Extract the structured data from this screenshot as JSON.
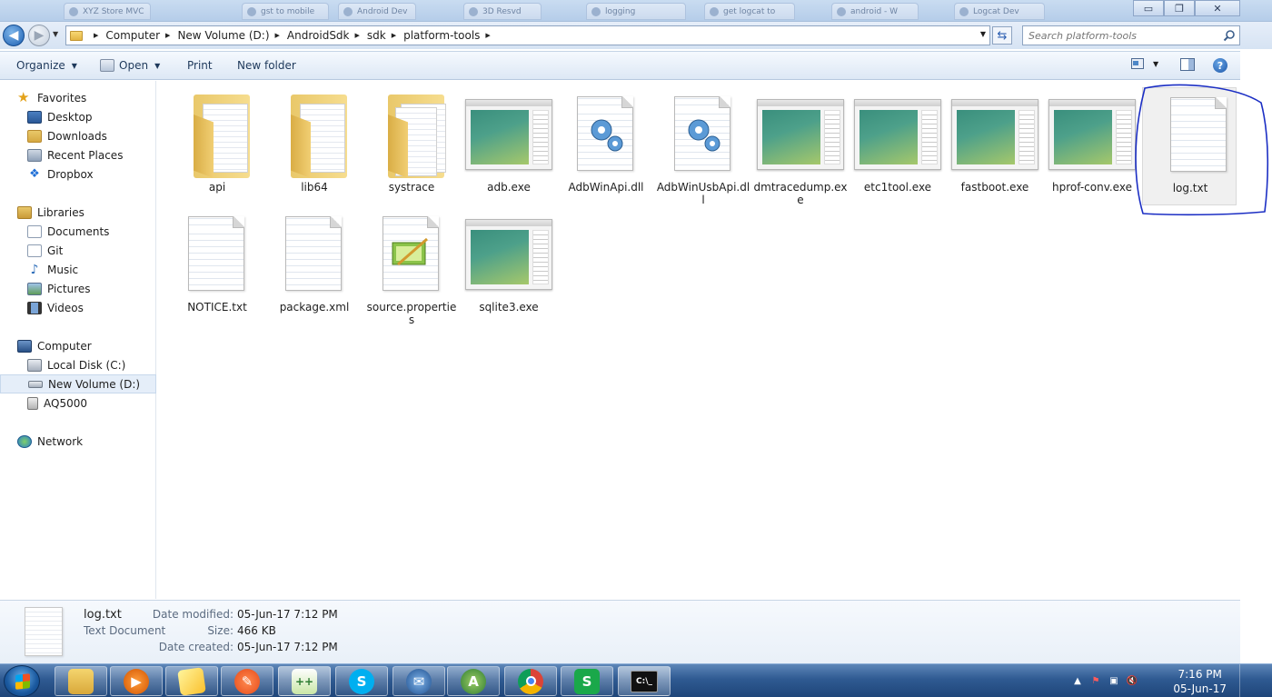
{
  "window": {
    "background_tabs": [
      "XYZ Store MVC",
      "gst to mobile",
      "Android Dev",
      "3D Resvd",
      "logging",
      "get logcat to",
      "android - W",
      "Logcat Dev"
    ],
    "minimize_glyph": "▭",
    "maximize_glyph": "❐",
    "close_glyph": "✕"
  },
  "address": {
    "crumbs": [
      "Computer",
      "New Volume (D:)",
      "AndroidSdk",
      "sdk",
      "platform-tools"
    ],
    "search_placeholder": "Search platform-tools"
  },
  "toolbar": {
    "organize": "Organize",
    "open": "Open",
    "print": "Print",
    "new_folder": "New folder"
  },
  "nav": {
    "favorites": {
      "label": "Favorites",
      "items": [
        "Desktop",
        "Downloads",
        "Recent Places",
        "Dropbox"
      ]
    },
    "libraries": {
      "label": "Libraries",
      "items": [
        "Documents",
        "Git",
        "Music",
        "Pictures",
        "Videos"
      ]
    },
    "computer": {
      "label": "Computer",
      "items": [
        "Local Disk (C:)",
        "New Volume (D:)",
        "AQ5000"
      ]
    },
    "network": {
      "label": "Network"
    }
  },
  "files": [
    {
      "name": "api",
      "kind": "folder"
    },
    {
      "name": "lib64",
      "kind": "folder"
    },
    {
      "name": "systrace",
      "kind": "folder"
    },
    {
      "name": "adb.exe",
      "kind": "exe"
    },
    {
      "name": "AdbWinApi.dll",
      "kind": "dll"
    },
    {
      "name": "AdbWinUsbApi.dll",
      "kind": "dll"
    },
    {
      "name": "dmtracedump.exe",
      "kind": "exe"
    },
    {
      "name": "etc1tool.exe",
      "kind": "exe"
    },
    {
      "name": "fastboot.exe",
      "kind": "exe"
    },
    {
      "name": "hprof-conv.exe",
      "kind": "exe"
    },
    {
      "name": "log.txt",
      "kind": "txt"
    },
    {
      "name": "NOTICE.txt",
      "kind": "txt"
    },
    {
      "name": "package.xml",
      "kind": "txt"
    },
    {
      "name": "source.properties",
      "kind": "props"
    },
    {
      "name": "sqlite3.exe",
      "kind": "exe"
    }
  ],
  "details": {
    "name": "log.txt",
    "type": "Text Document",
    "modified_label": "Date modified:",
    "modified": "05-Jun-17 7:12 PM",
    "size_label": "Size:",
    "size": "466 KB",
    "created_label": "Date created:",
    "created": "05-Jun-17 7:12 PM"
  },
  "taskbar": {
    "time": "7:16 PM",
    "date": "05-Jun-17"
  },
  "colors": {
    "selection_ring": "#1c2fc4",
    "accent": "#1e395b"
  }
}
